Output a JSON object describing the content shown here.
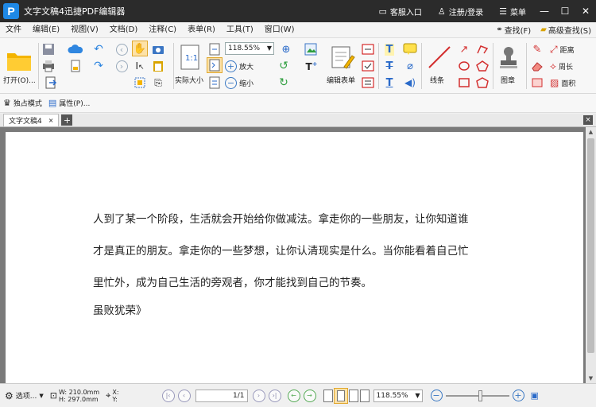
{
  "titlebar": {
    "logo_letter": "P",
    "title": "文字文稿4迅捷PDF编辑器",
    "service": "客服入口",
    "login": "注册/登录",
    "menu": "菜单"
  },
  "menubar": {
    "items": [
      "文件",
      "编辑(E)",
      "视图(V)",
      "文档(D)",
      "注释(C)",
      "表单(R)",
      "工具(T)",
      "窗口(W)"
    ],
    "find": "查找(F)",
    "advanced_find": "高级查找(S)"
  },
  "ribbon": {
    "open": "打开(O)...",
    "actual_size": "实际大小",
    "zoom_value": "118.55%",
    "zoom_in": "放大",
    "zoom_out": "缩小",
    "edit_form": "编辑表单",
    "line": "线条",
    "stamp": "图章",
    "distance": "距离",
    "perimeter": "周长",
    "area": "面积"
  },
  "subbar": {
    "exclusive_mode": "独占模式",
    "properties": "属性(P)..."
  },
  "tabs": {
    "doc_tab": "文字文稿4",
    "add": "+",
    "close_all": "×"
  },
  "document": {
    "lines": [
      "人到了某一个阶段，生活就会开始给你做减法。拿走你的一些朋友，让你知道谁",
      "才是真正的朋友。拿走你的一些梦想，让你认清现实是什么。当你能看着自己忙",
      "里忙外，成为自己生活的旁观者，你才能找到自己的节奏。",
      "虽败犹荣》"
    ]
  },
  "statusbar": {
    "options": "选项...",
    "width": "W: 210.0mm",
    "height": "H: 297.0mm",
    "x": "X:",
    "y": "Y:",
    "page": "1/1",
    "zoom": "118.55%",
    "zoom_level": 0.55
  },
  "colors": {
    "titlebar_bg": "#2b2b2b",
    "accent": "#1e88e5",
    "doc_bg": "#7a7a7a"
  }
}
